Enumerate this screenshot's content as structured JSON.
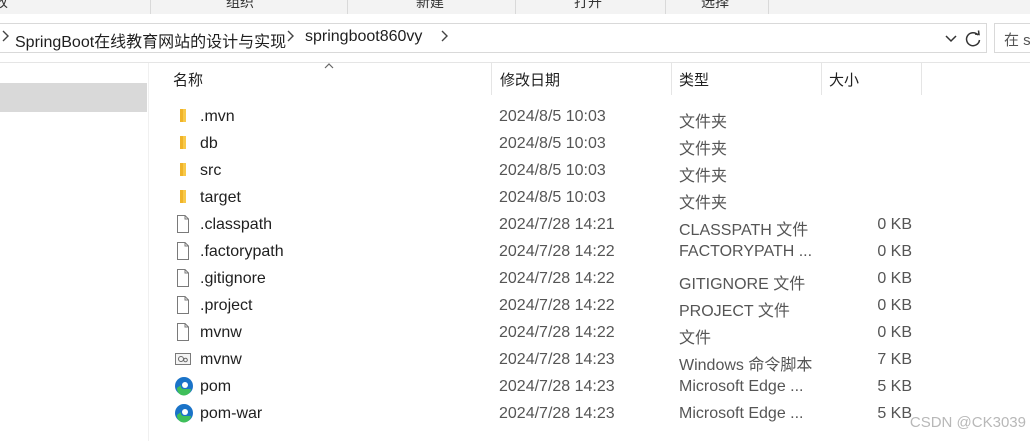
{
  "ribbon": {
    "groups": [
      "改",
      "组织",
      "新建",
      "打开",
      "选择"
    ]
  },
  "address": {
    "breadcrumbs": [
      "SpringBoot在线教育网站的设计与实现",
      "springboot860vy"
    ],
    "search_placeholder": "在 s"
  },
  "columns": {
    "name": "名称",
    "date": "修改日期",
    "type": "类型",
    "size": "大小"
  },
  "files": [
    {
      "name": ".mvn",
      "date": "2024/8/5 10:03",
      "type": "文件夹",
      "size": "",
      "icon": "folder-icon"
    },
    {
      "name": "db",
      "date": "2024/8/5 10:03",
      "type": "文件夹",
      "size": "",
      "icon": "folder-icon"
    },
    {
      "name": "src",
      "date": "2024/8/5 10:03",
      "type": "文件夹",
      "size": "",
      "icon": "folder-icon"
    },
    {
      "name": "target",
      "date": "2024/8/5 10:03",
      "type": "文件夹",
      "size": "",
      "icon": "folder-icon"
    },
    {
      "name": ".classpath",
      "date": "2024/7/28 14:21",
      "type": "CLASSPATH 文件",
      "size": "0 KB",
      "icon": "file-icon"
    },
    {
      "name": ".factorypath",
      "date": "2024/7/28 14:22",
      "type": "FACTORYPATH ...",
      "size": "0 KB",
      "icon": "file-icon"
    },
    {
      "name": ".gitignore",
      "date": "2024/7/28 14:22",
      "type": "GITIGNORE 文件",
      "size": "0 KB",
      "icon": "file-icon"
    },
    {
      "name": ".project",
      "date": "2024/7/28 14:22",
      "type": "PROJECT 文件",
      "size": "0 KB",
      "icon": "file-icon"
    },
    {
      "name": "mvnw",
      "date": "2024/7/28 14:22",
      "type": "文件",
      "size": "0 KB",
      "icon": "file-icon"
    },
    {
      "name": "mvnw",
      "date": "2024/7/28 14:23",
      "type": "Windows 命令脚本",
      "size": "7 KB",
      "icon": "script-icon"
    },
    {
      "name": "pom",
      "date": "2024/7/28 14:23",
      "type": "Microsoft Edge ...",
      "size": "5 KB",
      "icon": "edge-icon"
    },
    {
      "name": "pom-war",
      "date": "2024/7/28 14:23",
      "type": "Microsoft Edge ...",
      "size": "5 KB",
      "icon": "edge-icon"
    }
  ],
  "watermark": "CSDN @CK3039",
  "colors": {
    "folder": "#f8c94a",
    "nav_selected": "#d9d9d9",
    "edge_blue": "#1a73c8",
    "edge_green": "#3fbf5a"
  }
}
